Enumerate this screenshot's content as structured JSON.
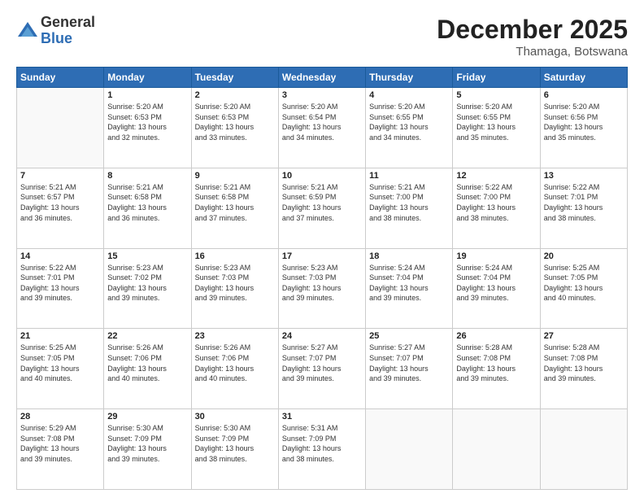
{
  "logo": {
    "general": "General",
    "blue": "Blue"
  },
  "header": {
    "month": "December 2025",
    "location": "Thamaga, Botswana"
  },
  "weekdays": [
    "Sunday",
    "Monday",
    "Tuesday",
    "Wednesday",
    "Thursday",
    "Friday",
    "Saturday"
  ],
  "weeks": [
    [
      {
        "day": "",
        "info": ""
      },
      {
        "day": "1",
        "info": "Sunrise: 5:20 AM\nSunset: 6:53 PM\nDaylight: 13 hours\nand 32 minutes."
      },
      {
        "day": "2",
        "info": "Sunrise: 5:20 AM\nSunset: 6:53 PM\nDaylight: 13 hours\nand 33 minutes."
      },
      {
        "day": "3",
        "info": "Sunrise: 5:20 AM\nSunset: 6:54 PM\nDaylight: 13 hours\nand 34 minutes."
      },
      {
        "day": "4",
        "info": "Sunrise: 5:20 AM\nSunset: 6:55 PM\nDaylight: 13 hours\nand 34 minutes."
      },
      {
        "day": "5",
        "info": "Sunrise: 5:20 AM\nSunset: 6:55 PM\nDaylight: 13 hours\nand 35 minutes."
      },
      {
        "day": "6",
        "info": "Sunrise: 5:20 AM\nSunset: 6:56 PM\nDaylight: 13 hours\nand 35 minutes."
      }
    ],
    [
      {
        "day": "7",
        "info": "Sunrise: 5:21 AM\nSunset: 6:57 PM\nDaylight: 13 hours\nand 36 minutes."
      },
      {
        "day": "8",
        "info": "Sunrise: 5:21 AM\nSunset: 6:58 PM\nDaylight: 13 hours\nand 36 minutes."
      },
      {
        "day": "9",
        "info": "Sunrise: 5:21 AM\nSunset: 6:58 PM\nDaylight: 13 hours\nand 37 minutes."
      },
      {
        "day": "10",
        "info": "Sunrise: 5:21 AM\nSunset: 6:59 PM\nDaylight: 13 hours\nand 37 minutes."
      },
      {
        "day": "11",
        "info": "Sunrise: 5:21 AM\nSunset: 7:00 PM\nDaylight: 13 hours\nand 38 minutes."
      },
      {
        "day": "12",
        "info": "Sunrise: 5:22 AM\nSunset: 7:00 PM\nDaylight: 13 hours\nand 38 minutes."
      },
      {
        "day": "13",
        "info": "Sunrise: 5:22 AM\nSunset: 7:01 PM\nDaylight: 13 hours\nand 38 minutes."
      }
    ],
    [
      {
        "day": "14",
        "info": "Sunrise: 5:22 AM\nSunset: 7:01 PM\nDaylight: 13 hours\nand 39 minutes."
      },
      {
        "day": "15",
        "info": "Sunrise: 5:23 AM\nSunset: 7:02 PM\nDaylight: 13 hours\nand 39 minutes."
      },
      {
        "day": "16",
        "info": "Sunrise: 5:23 AM\nSunset: 7:03 PM\nDaylight: 13 hours\nand 39 minutes."
      },
      {
        "day": "17",
        "info": "Sunrise: 5:23 AM\nSunset: 7:03 PM\nDaylight: 13 hours\nand 39 minutes."
      },
      {
        "day": "18",
        "info": "Sunrise: 5:24 AM\nSunset: 7:04 PM\nDaylight: 13 hours\nand 39 minutes."
      },
      {
        "day": "19",
        "info": "Sunrise: 5:24 AM\nSunset: 7:04 PM\nDaylight: 13 hours\nand 39 minutes."
      },
      {
        "day": "20",
        "info": "Sunrise: 5:25 AM\nSunset: 7:05 PM\nDaylight: 13 hours\nand 40 minutes."
      }
    ],
    [
      {
        "day": "21",
        "info": "Sunrise: 5:25 AM\nSunset: 7:05 PM\nDaylight: 13 hours\nand 40 minutes."
      },
      {
        "day": "22",
        "info": "Sunrise: 5:26 AM\nSunset: 7:06 PM\nDaylight: 13 hours\nand 40 minutes."
      },
      {
        "day": "23",
        "info": "Sunrise: 5:26 AM\nSunset: 7:06 PM\nDaylight: 13 hours\nand 40 minutes."
      },
      {
        "day": "24",
        "info": "Sunrise: 5:27 AM\nSunset: 7:07 PM\nDaylight: 13 hours\nand 39 minutes."
      },
      {
        "day": "25",
        "info": "Sunrise: 5:27 AM\nSunset: 7:07 PM\nDaylight: 13 hours\nand 39 minutes."
      },
      {
        "day": "26",
        "info": "Sunrise: 5:28 AM\nSunset: 7:08 PM\nDaylight: 13 hours\nand 39 minutes."
      },
      {
        "day": "27",
        "info": "Sunrise: 5:28 AM\nSunset: 7:08 PM\nDaylight: 13 hours\nand 39 minutes."
      }
    ],
    [
      {
        "day": "28",
        "info": "Sunrise: 5:29 AM\nSunset: 7:08 PM\nDaylight: 13 hours\nand 39 minutes."
      },
      {
        "day": "29",
        "info": "Sunrise: 5:30 AM\nSunset: 7:09 PM\nDaylight: 13 hours\nand 39 minutes."
      },
      {
        "day": "30",
        "info": "Sunrise: 5:30 AM\nSunset: 7:09 PM\nDaylight: 13 hours\nand 38 minutes."
      },
      {
        "day": "31",
        "info": "Sunrise: 5:31 AM\nSunset: 7:09 PM\nDaylight: 13 hours\nand 38 minutes."
      },
      {
        "day": "",
        "info": ""
      },
      {
        "day": "",
        "info": ""
      },
      {
        "day": "",
        "info": ""
      }
    ]
  ]
}
